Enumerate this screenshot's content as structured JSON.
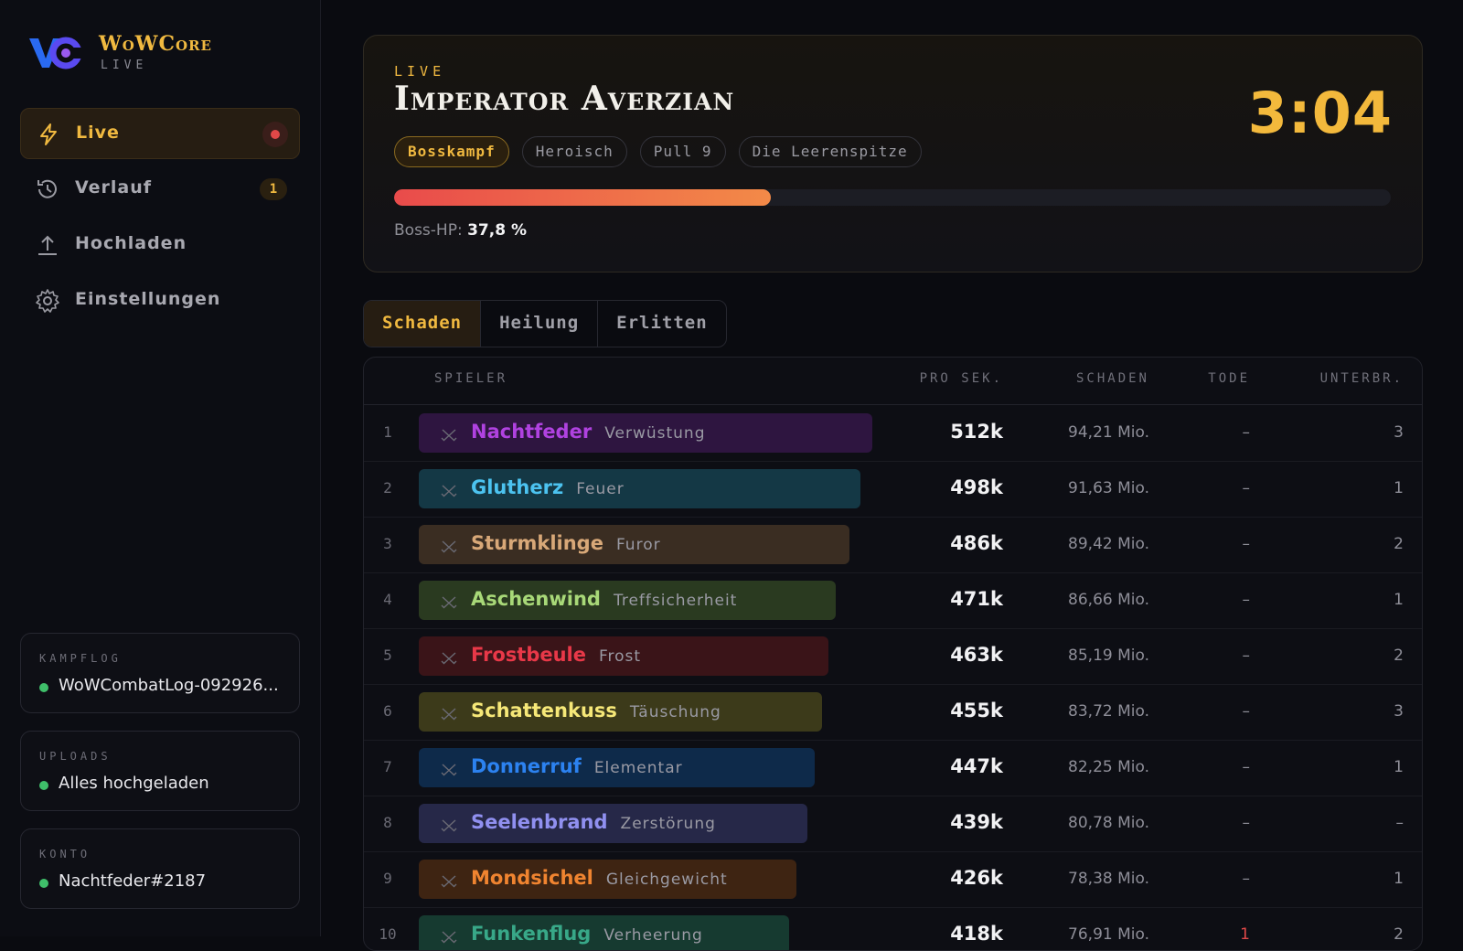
{
  "app": {
    "title": "WoWCore",
    "subtitle": "LIVE"
  },
  "nav": {
    "items": [
      {
        "label": "Live",
        "icon": "bolt-icon",
        "active": true,
        "live_indicator": true
      },
      {
        "label": "Verlauf",
        "icon": "history-icon",
        "badge": "1"
      },
      {
        "label": "Hochladen",
        "icon": "upload-icon"
      },
      {
        "label": "Einstellungen",
        "icon": "gear-icon"
      }
    ]
  },
  "status": {
    "combatlog": {
      "label": "KAMPFLOG",
      "value": "WoWCombatLog-092926..."
    },
    "uploads": {
      "label": "UPLOADS",
      "value": "Alles hochgeladen"
    },
    "account": {
      "label": "KONTO",
      "value": "Nachtfeder#2187"
    }
  },
  "encounter": {
    "tag": "LIVE",
    "title": "Imperator Averzian",
    "pills": [
      "Bosskampf",
      "Heroisch",
      "Pull 9",
      "Die Leerenspitze"
    ],
    "timer": "3:04",
    "hp_label": "Boss-HP:",
    "hp_value": "37,8 %",
    "hp_fraction": 0.378
  },
  "tabs": [
    "Schaden",
    "Heilung",
    "Erlitten"
  ],
  "active_tab": 0,
  "table": {
    "columns": {
      "player": "SPIELER",
      "dps": "PRO SEK.",
      "damage": "SCHADEN",
      "deaths": "TODE",
      "interrupts": "UNTERBR."
    },
    "rows": [
      {
        "rank": "1",
        "name": "Nachtfeder",
        "spec": "Verwüstung",
        "dps": "512k",
        "damage": "94,21 Mio.",
        "deaths": "–",
        "interrupts": "3",
        "share": 1.0,
        "color": "#b042e0",
        "bg": "#2e1540"
      },
      {
        "rank": "2",
        "name": "Glutherz",
        "spec": "Feuer",
        "dps": "498k",
        "damage": "91,63 Mio.",
        "deaths": "–",
        "interrupts": "1",
        "share": 0.973,
        "color": "#4cc3f0",
        "bg": "#143845"
      },
      {
        "rank": "3",
        "name": "Sturmklinge",
        "spec": "Furor",
        "dps": "486k",
        "damage": "89,42 Mio.",
        "deaths": "–",
        "interrupts": "2",
        "share": 0.949,
        "color": "#d8a878",
        "bg": "#3a2d22"
      },
      {
        "rank": "4",
        "name": "Aschenwind",
        "spec": "Treffsicherheit",
        "dps": "471k",
        "damage": "86,66 Mio.",
        "deaths": "–",
        "interrupts": "1",
        "share": 0.92,
        "color": "#a8d878",
        "bg": "#2a3a20"
      },
      {
        "rank": "5",
        "name": "Frostbeule",
        "spec": "Frost",
        "dps": "463k",
        "damage": "85,19 Mio.",
        "deaths": "–",
        "interrupts": "2",
        "share": 0.904,
        "color": "#e83848",
        "bg": "#3a1418"
      },
      {
        "rank": "6",
        "name": "Schattenkuss",
        "spec": "Täuschung",
        "dps": "455k",
        "damage": "83,72 Mio.",
        "deaths": "–",
        "interrupts": "3",
        "share": 0.889,
        "color": "#f6e878",
        "bg": "#3c3a1a"
      },
      {
        "rank": "7",
        "name": "Donnerruf",
        "spec": "Elementar",
        "dps": "447k",
        "damage": "82,25 Mio.",
        "deaths": "–",
        "interrupts": "1",
        "share": 0.873,
        "color": "#2c82f0",
        "bg": "#0e2a4a"
      },
      {
        "rank": "8",
        "name": "Seelenbrand",
        "spec": "Zerstörung",
        "dps": "439k",
        "damage": "80,78 Mio.",
        "deaths": "–",
        "interrupts": "–",
        "share": 0.857,
        "color": "#9090f0",
        "bg": "#262848"
      },
      {
        "rank": "9",
        "name": "Mondsichel",
        "spec": "Gleichgewicht",
        "dps": "426k",
        "damage": "78,38 Mio.",
        "deaths": "–",
        "interrupts": "1",
        "share": 0.832,
        "color": "#f08430",
        "bg": "#3e2412"
      },
      {
        "rank": "10",
        "name": "Funkenflug",
        "spec": "Verheerung",
        "dps": "418k",
        "damage": "76,91 Mio.",
        "deaths": "1",
        "interrupts": "2",
        "share": 0.816,
        "color": "#38a888",
        "bg": "#163a30"
      }
    ]
  }
}
